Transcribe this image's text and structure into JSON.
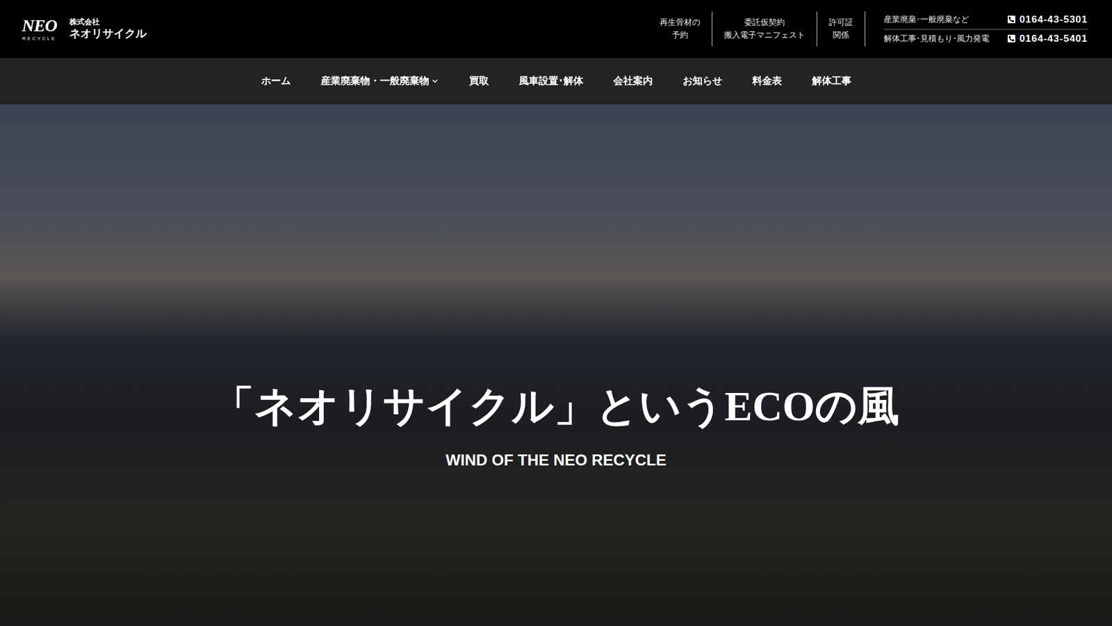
{
  "logo": {
    "mark": "NEO",
    "sub": "RECYCLE",
    "company_prefix": "株式会社",
    "company_name": "ネオリサイクル"
  },
  "header_links": [
    {
      "lines": [
        "再生骨材の",
        "予約"
      ]
    },
    {
      "lines": [
        "委託仮契約",
        "搬入電子マニフェスト"
      ]
    },
    {
      "lines": [
        "許可証",
        "関係"
      ]
    }
  ],
  "contacts": [
    {
      "label": "産業廃棄･一般廃棄など",
      "phone": "0164-43-5301"
    },
    {
      "label": "解体工事･見積もり･風力発電",
      "phone": "0164-43-5401"
    }
  ],
  "nav": [
    {
      "label": "ホーム",
      "has_dropdown": false
    },
    {
      "label": "産業廃棄物・一般廃棄物",
      "has_dropdown": true
    },
    {
      "label": "買取",
      "has_dropdown": false
    },
    {
      "label": "風車設置･解体",
      "has_dropdown": false
    },
    {
      "label": "会社案内",
      "has_dropdown": false
    },
    {
      "label": "お知らせ",
      "has_dropdown": false
    },
    {
      "label": "料金表",
      "has_dropdown": false
    },
    {
      "label": "解体工事",
      "has_dropdown": false
    }
  ],
  "hero": {
    "title": "「ネオリサイクル」というECOの風",
    "subtitle": "WIND OF THE NEO RECYCLE"
  }
}
